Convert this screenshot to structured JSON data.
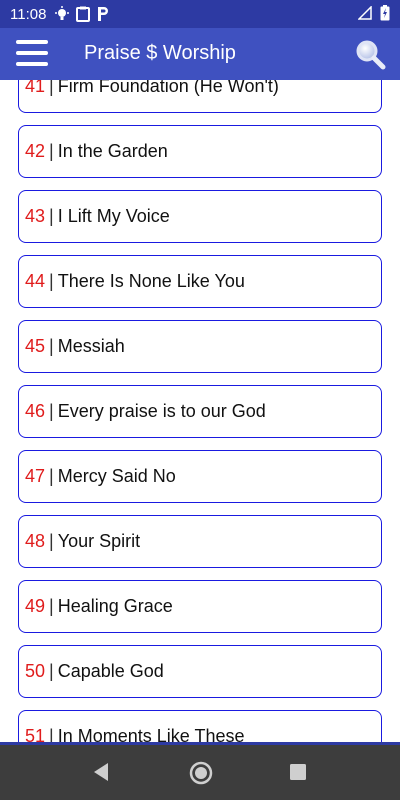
{
  "status_bar": {
    "time": "11:08"
  },
  "app_bar": {
    "title": "Praise $ Worship"
  },
  "songs": [
    {
      "number": "41",
      "title": "Firm Foundation (He Won't)"
    },
    {
      "number": "42",
      "title": "In the Garden"
    },
    {
      "number": "43",
      "title": "I Lift My Voice"
    },
    {
      "number": "44",
      "title": "There Is None Like You"
    },
    {
      "number": "45",
      "title": "Messiah"
    },
    {
      "number": "46",
      "title": "Every praise is to our God"
    },
    {
      "number": "47",
      "title": "Mercy Said No"
    },
    {
      "number": "48",
      "title": "Your Spirit"
    },
    {
      "number": "49",
      "title": "Healing Grace"
    },
    {
      "number": "50",
      "title": "Capable God"
    },
    {
      "number": "51",
      "title": "In Moments Like These"
    }
  ],
  "separator": "|",
  "colors": {
    "status_bar": "#2d3aa3",
    "app_bar": "#3f51c0",
    "item_border": "#1a1ae0",
    "song_number": "#e01c1c",
    "nav_bar": "#3d3d3d"
  },
  "icons": {
    "menu": "hamburger-menu-icon",
    "search": "search-icon",
    "back": "back-triangle-icon",
    "home": "home-circle-icon",
    "recent": "recent-apps-square-icon"
  }
}
